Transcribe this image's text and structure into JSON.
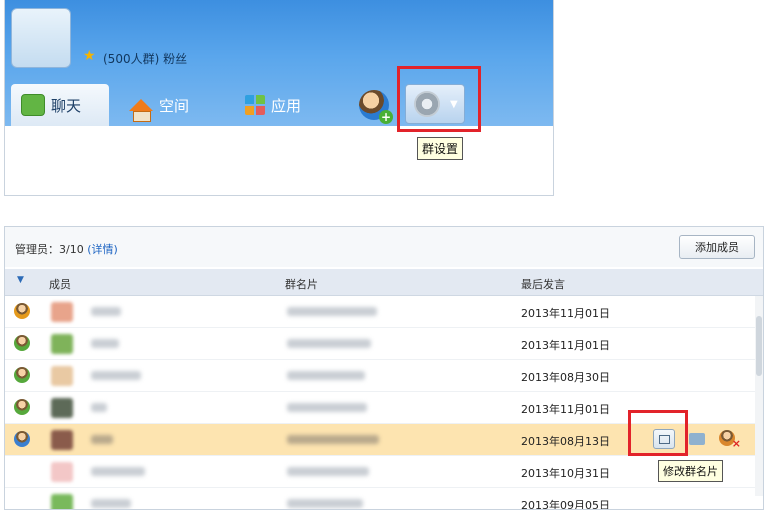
{
  "header": {
    "group_info": "(500人群) 粉丝",
    "tabs": [
      {
        "label": "聊天",
        "icon": "chat-icon",
        "active": true
      },
      {
        "label": "空间",
        "icon": "house-icon",
        "active": false
      },
      {
        "label": "应用",
        "icon": "apps-grid-icon",
        "active": false
      }
    ],
    "settings_tooltip": "群设置"
  },
  "members": {
    "admin_label": "管理员：3/10",
    "admin_details": "(详情)",
    "add_member_label": "添加成员",
    "columns": [
      "成员",
      "群名片",
      "最后发言"
    ],
    "rows": [
      {
        "role": "owner",
        "last_post": "2013年11月01日"
      },
      {
        "role": "admin",
        "last_post": "2013年11月01日"
      },
      {
        "role": "admin",
        "last_post": "2013年08月30日"
      },
      {
        "role": "admin",
        "last_post": "2013年11月01日"
      },
      {
        "role": "member",
        "last_post": "2013年08月13日",
        "selected": true
      },
      {
        "role": "none",
        "last_post": "2013年10月31日"
      },
      {
        "role": "none",
        "last_post": "2013年09月05日"
      }
    ],
    "edit_card_tooltip": "修改群名片"
  },
  "colors": {
    "header_blue": "#4a9be6",
    "highlight_red": "#e2232a",
    "selected_row": "#fde4b0",
    "link_blue": "#1e65c3"
  }
}
